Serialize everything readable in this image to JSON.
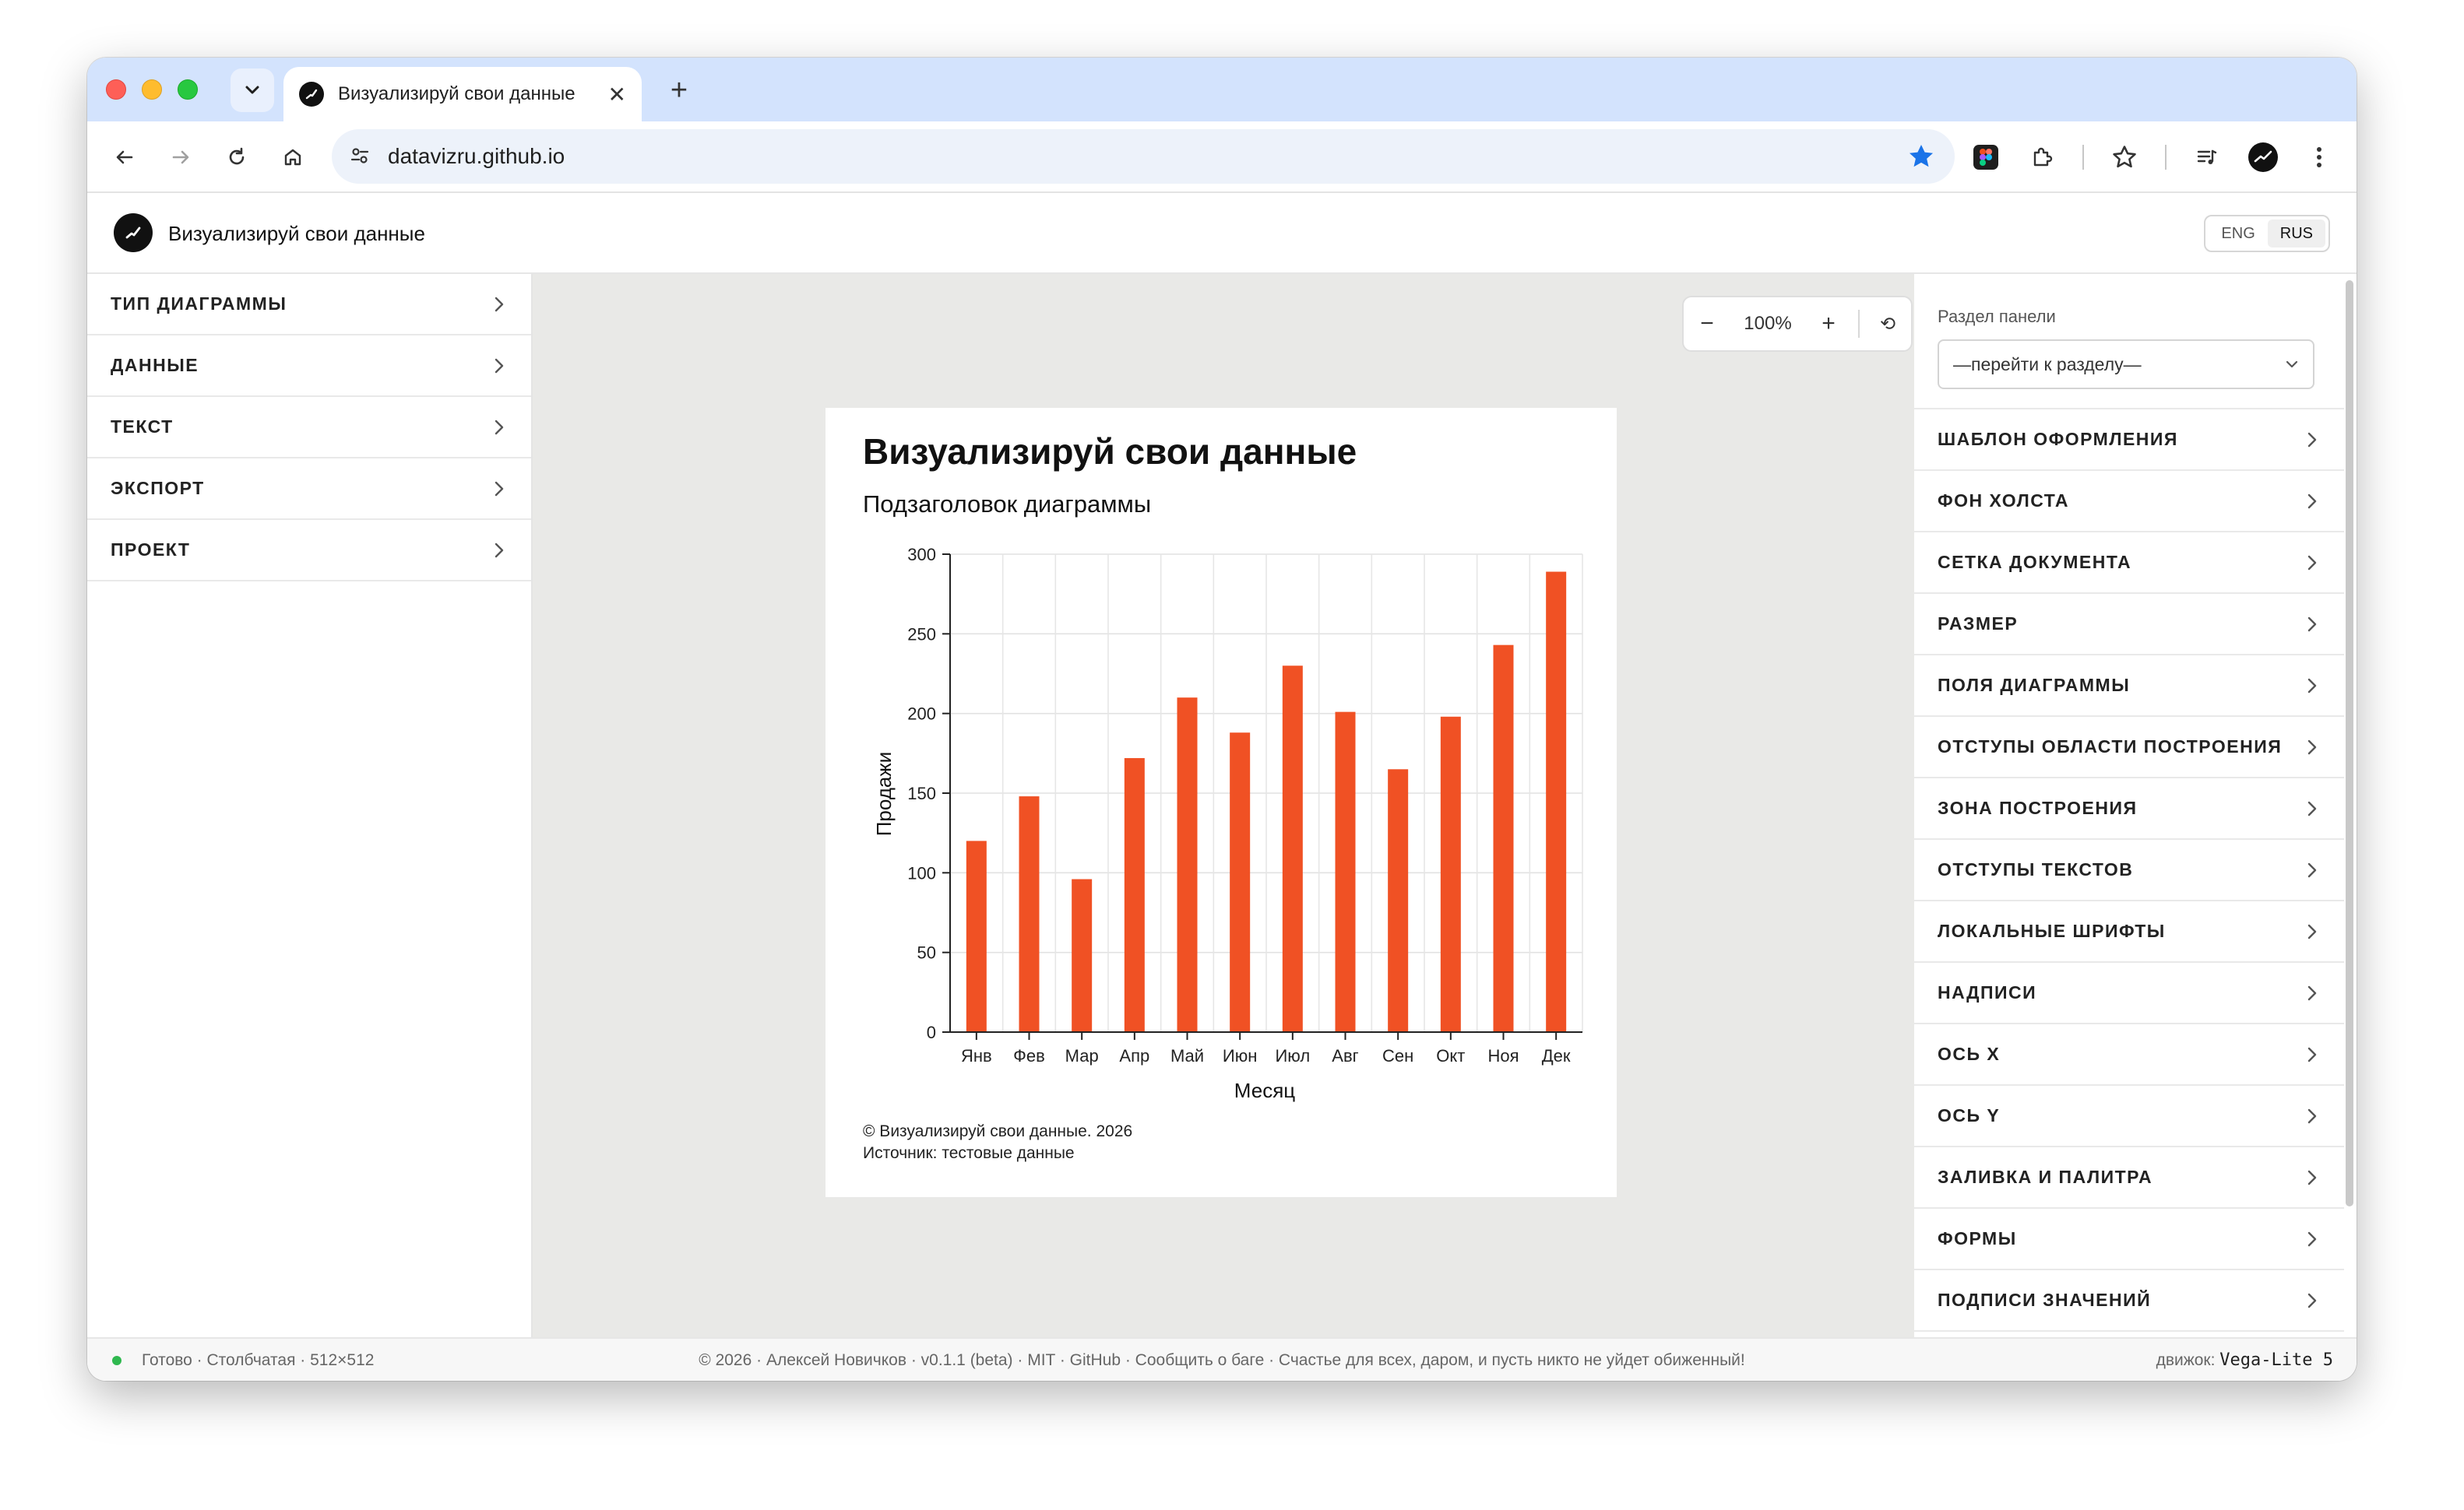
{
  "browser": {
    "tab_title": "Визуализируй свои данные",
    "url": "datavizru.github.io"
  },
  "app": {
    "title": "Визуализируй свои данные",
    "lang": [
      "ENG",
      "RUS"
    ],
    "active_lang": "RUS"
  },
  "left_panel": {
    "items": [
      {
        "label": "ТИП ДИАГРАММЫ"
      },
      {
        "label": "ДАННЫЕ"
      },
      {
        "label": "ТЕКСТ"
      },
      {
        "label": "ЭКСПОРТ"
      },
      {
        "label": "ПРОЕКТ"
      }
    ]
  },
  "zoom": {
    "minus": "−",
    "value": "100%",
    "plus": "+",
    "reset": "⟲"
  },
  "right_panel": {
    "section_label": "Раздел панели",
    "select_value": "—перейти к разделу—",
    "items": [
      {
        "label": "ШАБЛОН ОФОРМЛЕНИЯ"
      },
      {
        "label": "ФОН ХОЛСТА"
      },
      {
        "label": "СЕТКА ДОКУМЕНТА"
      },
      {
        "label": "РАЗМЕР"
      },
      {
        "label": "ПОЛЯ ДИАГРАММЫ"
      },
      {
        "label": "ОТСТУПЫ ОБЛАСТИ ПОСТРОЕНИЯ"
      },
      {
        "label": "ЗОНА ПОСТРОЕНИЯ"
      },
      {
        "label": "ОТСТУПЫ ТЕКСТОВ"
      },
      {
        "label": "ЛОКАЛЬНЫЕ ШРИФТЫ"
      },
      {
        "label": "НАДПИСИ"
      },
      {
        "label": "ОСЬ X"
      },
      {
        "label": "ОСЬ Y"
      },
      {
        "label": "ЗАЛИВКА И ПАЛИТРА"
      },
      {
        "label": "ФОРМЫ"
      },
      {
        "label": "ПОДПИСИ ЗНАЧЕНИЙ"
      }
    ]
  },
  "status": {
    "left": "Готово · Столбчатая · 512×512",
    "center": "© 2026 · Алексей Новичков · v0.1.1 (beta) · MIT · GitHub · Сообщить о баге · Счастье для всех, даром, и пусть никто не уйдет обиженный!",
    "engine_label": "движок:",
    "engine_value": "Vega-Lite 5"
  },
  "colors": {
    "bar": "#f05124",
    "tabbar": "#d3e3fd",
    "star": "#1a73e8",
    "status_dot": "#2fb84f"
  },
  "chart_data": {
    "type": "bar",
    "title": "Визуализируй свои данные",
    "subtitle": "Подзаголовок диаграммы",
    "xlabel": "Месяц",
    "ylabel": "Продажи",
    "categories": [
      "Янв",
      "Фев",
      "Мар",
      "Апр",
      "Май",
      "Июн",
      "Июл",
      "Авг",
      "Сен",
      "Окт",
      "Ноя",
      "Дек"
    ],
    "values": [
      120,
      148,
      96,
      172,
      210,
      188,
      230,
      201,
      165,
      198,
      243,
      289
    ],
    "ylim": [
      0,
      300
    ],
    "yticks": [
      0,
      50,
      100,
      150,
      200,
      250,
      300
    ],
    "grid": true,
    "footer": [
      "© Визуализируй свои данные. 2026",
      "Источник: тестовые данные"
    ]
  }
}
